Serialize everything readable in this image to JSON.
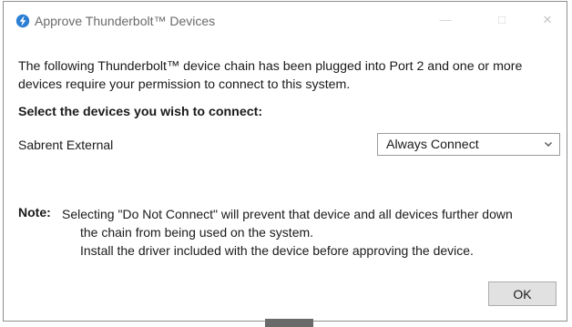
{
  "window": {
    "title": "Approve Thunderbolt™ Devices",
    "controls": {
      "minimize": "—",
      "maximize": "□",
      "close": "✕"
    }
  },
  "message": {
    "line1": "The following Thunderbolt™ device chain has been plugged into Port 2 and one or more",
    "line2": "devices require your permission to connect to this system."
  },
  "heading": "Select the devices you wish to connect:",
  "devices": [
    {
      "name": "Sabrent External",
      "selection": "Always Connect"
    }
  ],
  "note": {
    "label": "Note:",
    "line1": "Selecting \"Do Not Connect\" will prevent that device and all devices further down",
    "line2": "the chain from being used on the system.",
    "line3": "Install the driver included with the device before approving the device."
  },
  "buttons": {
    "ok": "OK"
  },
  "icons": {
    "app": "thunderbolt-icon",
    "dropdown": "chevron-down-icon"
  },
  "colors": {
    "accent": "#2a7fd4",
    "button_bg": "#e1e1e1",
    "border": "#9b9b9b"
  }
}
